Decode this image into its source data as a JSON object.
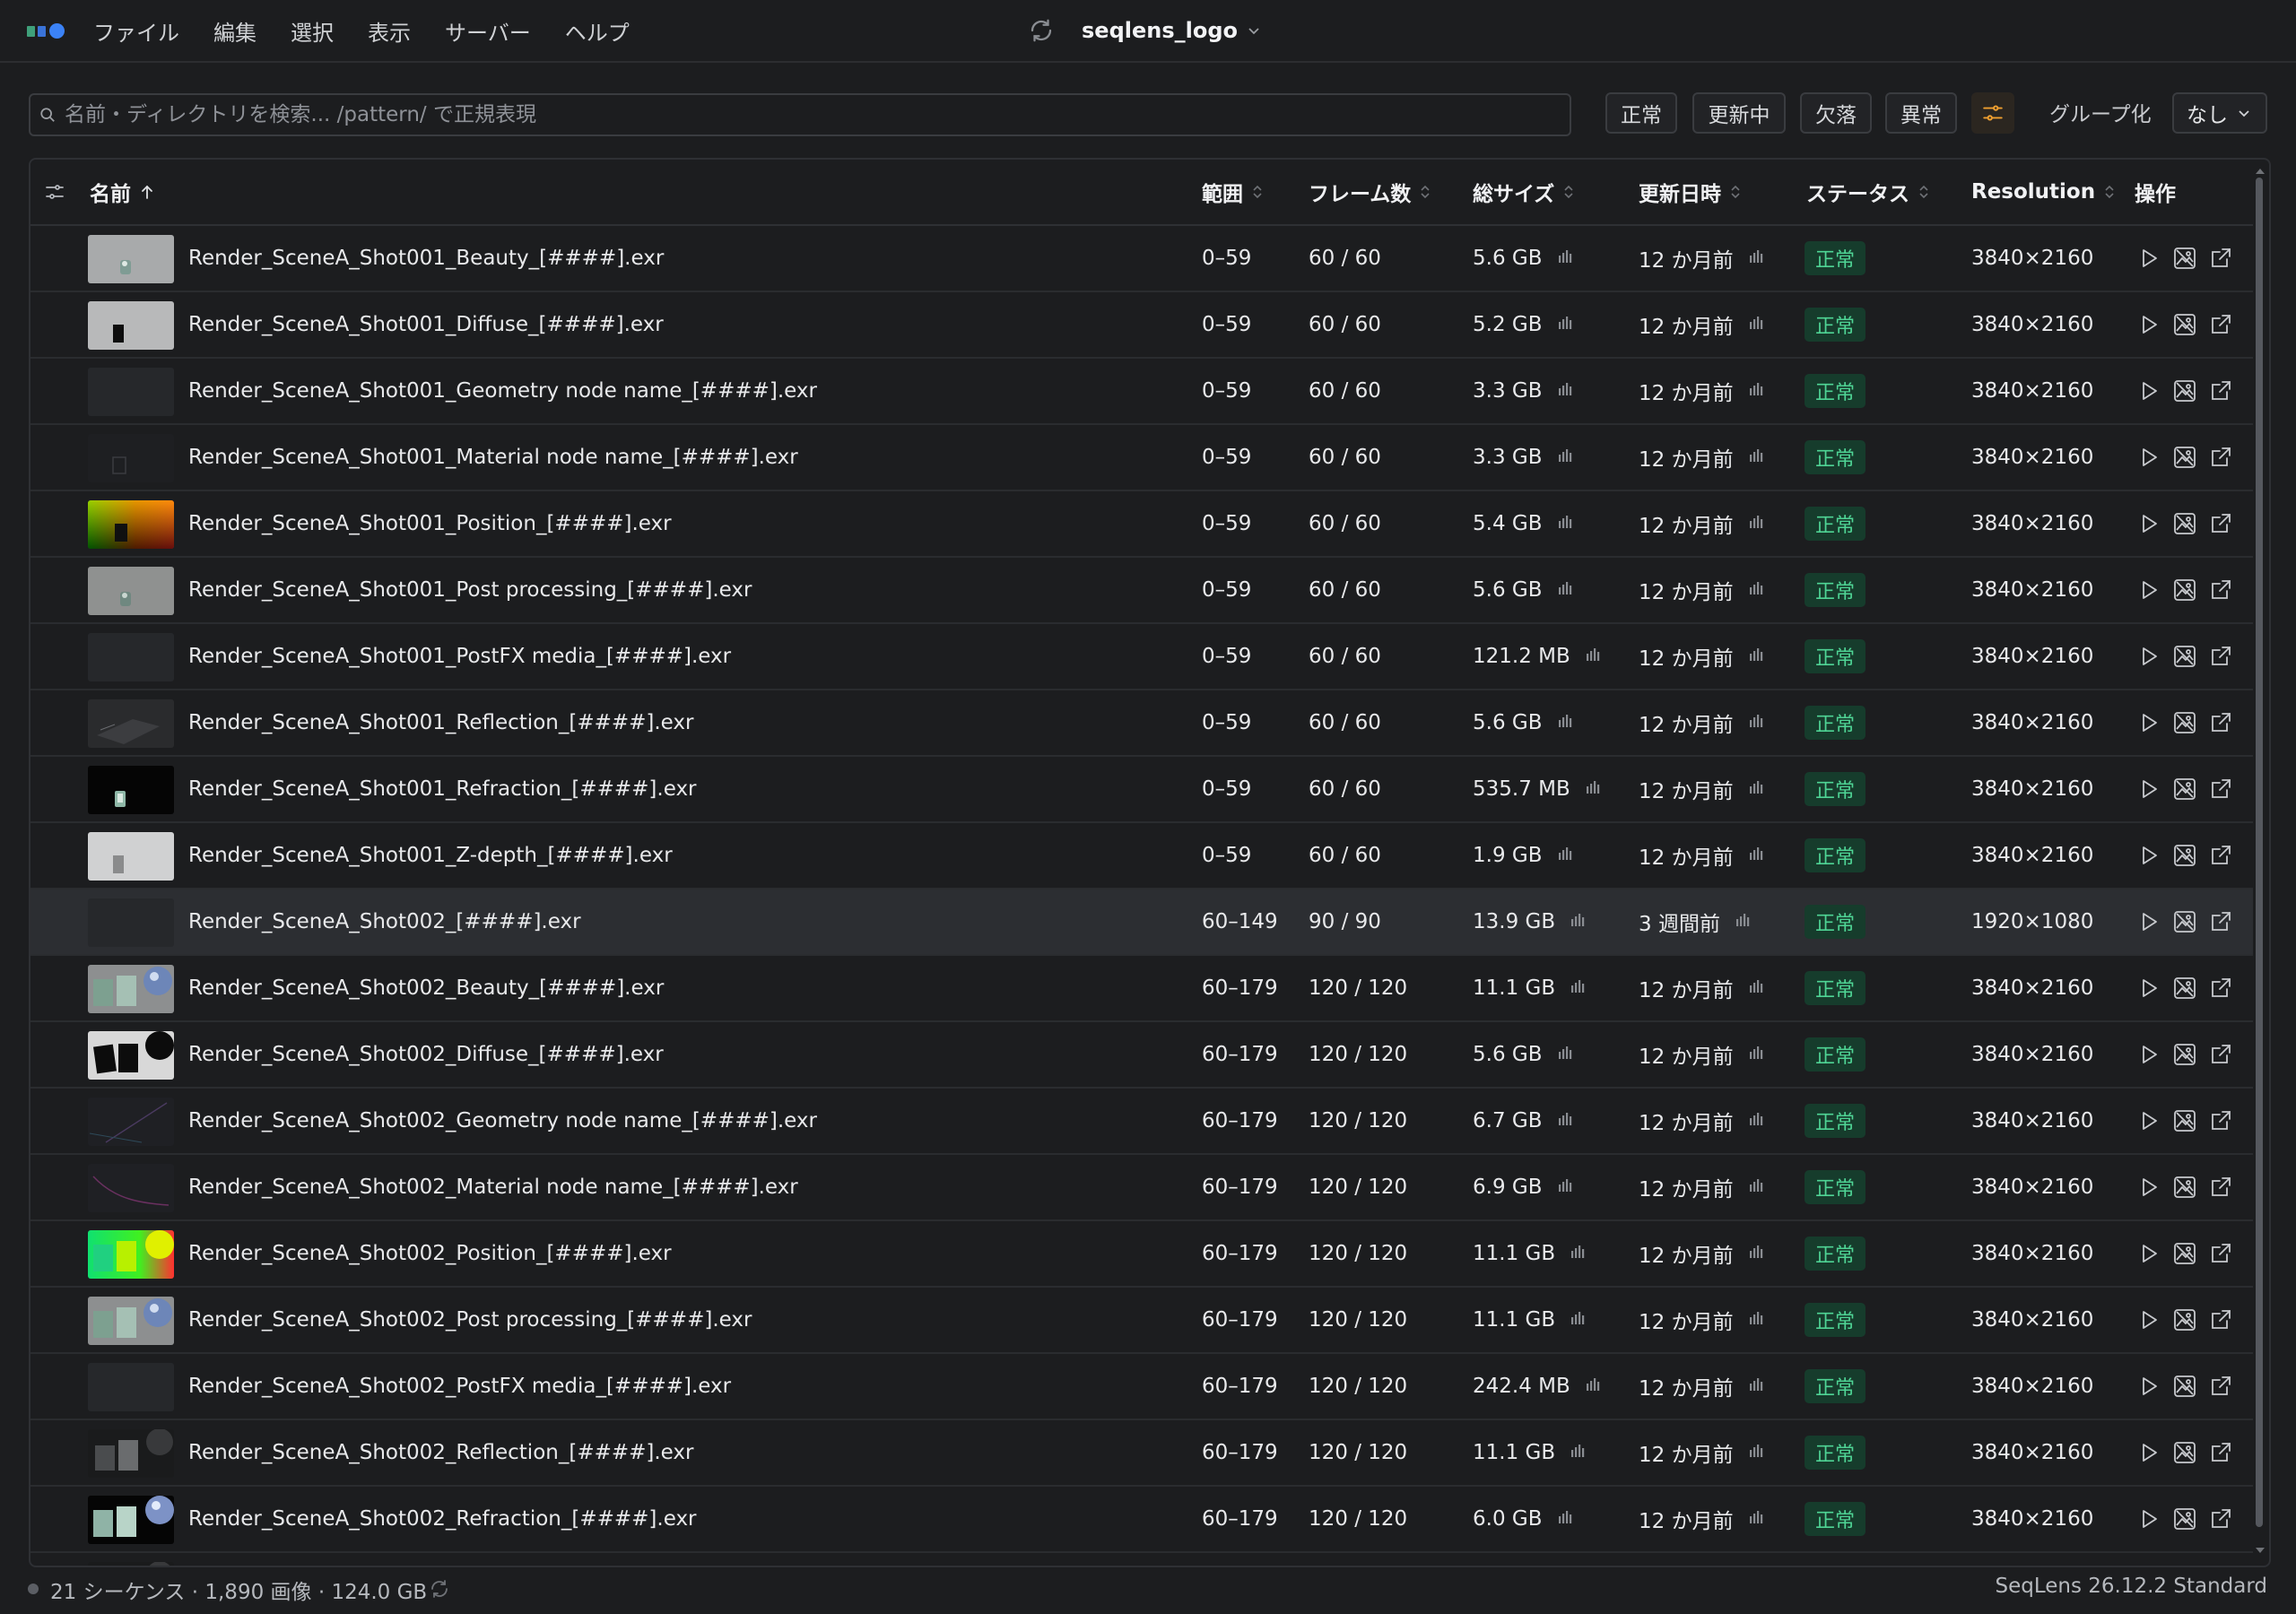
{
  "menu": [
    "ファイル",
    "編集",
    "選択",
    "表示",
    "サーバー",
    "ヘルプ"
  ],
  "window": {
    "title": "seqlens_logo"
  },
  "search": {
    "placeholder": "名前・ディレクトリを検索... /pattern/ で正規表現",
    "value": ""
  },
  "filters": [
    "正常",
    "更新中",
    "欠落",
    "異常"
  ],
  "group_by": {
    "label": "グループ化",
    "value": "なし"
  },
  "columns": {
    "name": "名前",
    "range": "範囲",
    "frames": "フレーム数",
    "size": "総サイズ",
    "updated": "更新日時",
    "status": "ステータス",
    "resolution": "Resolution",
    "actions": "操作"
  },
  "rows": [
    {
      "name": "Render_SceneA_Shot001_Beauty_[####].exr",
      "range": "0–59",
      "frames": "60 / 60",
      "size": "5.6 GB",
      "updated": "12 か月前",
      "status": "正常",
      "resolution": "3840×2160",
      "thumb": "beauty1"
    },
    {
      "name": "Render_SceneA_Shot001_Diffuse_[####].exr",
      "range": "0–59",
      "frames": "60 / 60",
      "size": "5.2 GB",
      "updated": "12 か月前",
      "status": "正常",
      "resolution": "3840×2160",
      "thumb": "diffuse1"
    },
    {
      "name": "Render_SceneA_Shot001_Geometry node name_[####].exr",
      "range": "0–59",
      "frames": "60 / 60",
      "size": "3.3 GB",
      "updated": "12 か月前",
      "status": "正常",
      "resolution": "3840×2160",
      "thumb": "dark"
    },
    {
      "name": "Render_SceneA_Shot001_Material node name_[####].exr",
      "range": "0–59",
      "frames": "60 / 60",
      "size": "3.3 GB",
      "updated": "12 か月前",
      "status": "正常",
      "resolution": "3840×2160",
      "thumb": "material1"
    },
    {
      "name": "Render_SceneA_Shot001_Position_[####].exr",
      "range": "0–59",
      "frames": "60 / 60",
      "size": "5.4 GB",
      "updated": "12 か月前",
      "status": "正常",
      "resolution": "3840×2160",
      "thumb": "position1"
    },
    {
      "name": "Render_SceneA_Shot001_Post processing_[####].exr",
      "range": "0–59",
      "frames": "60 / 60",
      "size": "5.6 GB",
      "updated": "12 か月前",
      "status": "正常",
      "resolution": "3840×2160",
      "thumb": "post1"
    },
    {
      "name": "Render_SceneA_Shot001_PostFX media_[####].exr",
      "range": "0–59",
      "frames": "60 / 60",
      "size": "121.2 MB",
      "updated": "12 か月前",
      "status": "正常",
      "resolution": "3840×2160",
      "thumb": "dark"
    },
    {
      "name": "Render_SceneA_Shot001_Reflection_[####].exr",
      "range": "0–59",
      "frames": "60 / 60",
      "size": "5.6 GB",
      "updated": "12 か月前",
      "status": "正常",
      "resolution": "3840×2160",
      "thumb": "reflection1"
    },
    {
      "name": "Render_SceneA_Shot001_Refraction_[####].exr",
      "range": "0–59",
      "frames": "60 / 60",
      "size": "535.7 MB",
      "updated": "12 か月前",
      "status": "正常",
      "resolution": "3840×2160",
      "thumb": "refraction1"
    },
    {
      "name": "Render_SceneA_Shot001_Z-depth_[####].exr",
      "range": "0–59",
      "frames": "60 / 60",
      "size": "1.9 GB",
      "updated": "12 か月前",
      "status": "正常",
      "resolution": "3840×2160",
      "thumb": "zdepth1"
    },
    {
      "name": "Render_SceneA_Shot002_[####].exr",
      "range": "60–149",
      "frames": "90 / 90",
      "size": "13.9 GB",
      "updated": "3 週間前",
      "status": "正常",
      "resolution": "1920×1080",
      "thumb": "dark",
      "selected": true
    },
    {
      "name": "Render_SceneA_Shot002_Beauty_[####].exr",
      "range": "60–179",
      "frames": "120 / 120",
      "size": "11.1 GB",
      "updated": "12 か月前",
      "status": "正常",
      "resolution": "3840×2160",
      "thumb": "beauty2"
    },
    {
      "name": "Render_SceneA_Shot002_Diffuse_[####].exr",
      "range": "60–179",
      "frames": "120 / 120",
      "size": "5.6 GB",
      "updated": "12 か月前",
      "status": "正常",
      "resolution": "3840×2160",
      "thumb": "diffuse2"
    },
    {
      "name": "Render_SceneA_Shot002_Geometry node name_[####].exr",
      "range": "60–179",
      "frames": "120 / 120",
      "size": "6.7 GB",
      "updated": "12 か月前",
      "status": "正常",
      "resolution": "3840×2160",
      "thumb": "geometry2"
    },
    {
      "name": "Render_SceneA_Shot002_Material node name_[####].exr",
      "range": "60–179",
      "frames": "120 / 120",
      "size": "6.9 GB",
      "updated": "12 か月前",
      "status": "正常",
      "resolution": "3840×2160",
      "thumb": "material2"
    },
    {
      "name": "Render_SceneA_Shot002_Position_[####].exr",
      "range": "60–179",
      "frames": "120 / 120",
      "size": "11.1 GB",
      "updated": "12 か月前",
      "status": "正常",
      "resolution": "3840×2160",
      "thumb": "position2"
    },
    {
      "name": "Render_SceneA_Shot002_Post processing_[####].exr",
      "range": "60–179",
      "frames": "120 / 120",
      "size": "11.1 GB",
      "updated": "12 か月前",
      "status": "正常",
      "resolution": "3840×2160",
      "thumb": "beauty2"
    },
    {
      "name": "Render_SceneA_Shot002_PostFX media_[####].exr",
      "range": "60–179",
      "frames": "120 / 120",
      "size": "242.4 MB",
      "updated": "12 か月前",
      "status": "正常",
      "resolution": "3840×2160",
      "thumb": "dark"
    },
    {
      "name": "Render_SceneA_Shot002_Reflection_[####].exr",
      "range": "60–179",
      "frames": "120 / 120",
      "size": "11.1 GB",
      "updated": "12 か月前",
      "status": "正常",
      "resolution": "3840×2160",
      "thumb": "reflection2"
    },
    {
      "name": "Render_SceneA_Shot002_Refraction_[####].exr",
      "range": "60–179",
      "frames": "120 / 120",
      "size": "6.0 GB",
      "updated": "12 か月前",
      "status": "正常",
      "resolution": "3840×2160",
      "thumb": "refraction2"
    }
  ],
  "icons": {
    "row_actions": [
      "play-icon",
      "image-compare-icon",
      "open-external-icon"
    ],
    "size_trend": "bar-chart-icon",
    "filter_toggle": "sliders-icon",
    "sync": "sync-icon"
  },
  "colors": {
    "accent": "#3b82f6",
    "status_ok_bg": "#163c2c",
    "status_ok_text": "#4fd495",
    "filter_active": "#f0a030"
  },
  "statusbar": {
    "summary": "21 シーケンス · 1,890 画像 · 124.0 GB",
    "version": "SeqLens 26.12.2 Standard"
  }
}
